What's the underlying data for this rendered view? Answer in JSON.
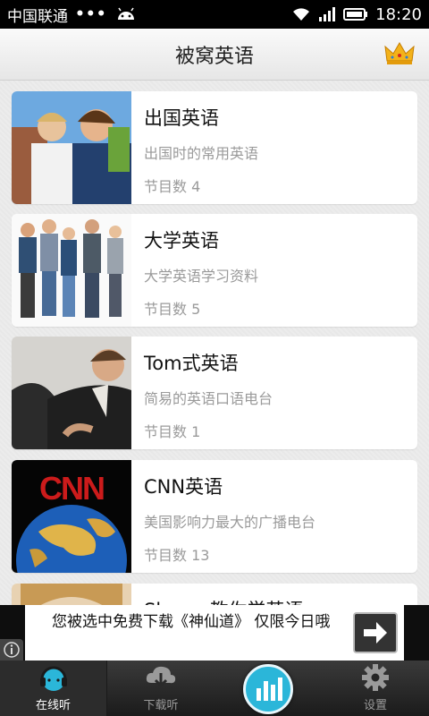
{
  "statusbar": {
    "carrier": "中国联通",
    "dots": "•••",
    "time": "18:20"
  },
  "header": {
    "title": "被窝英语"
  },
  "courses": [
    {
      "title": "出国英语",
      "subtitle": "出国时的常用英语",
      "count": "节目数 4"
    },
    {
      "title": "大学英语",
      "subtitle": "大学英语学习资料",
      "count": "节目数 5"
    },
    {
      "title": "Tom式英语",
      "subtitle": "简易的英语口语电台",
      "count": "节目数 1"
    },
    {
      "title": "CNN英语",
      "subtitle": "美国影响力最大的广播电台",
      "count": "节目数 13"
    },
    {
      "title": "Shoo…教你学英语"
    }
  ],
  "ad": {
    "text": "您被选中免费下载《神仙道》 仅限今日哦"
  },
  "tabs": [
    {
      "label": "在线听",
      "icon": "headphones-icon",
      "active": true
    },
    {
      "label": "下载听",
      "icon": "download-icon"
    },
    {
      "label": "",
      "icon": "equalizer-icon"
    },
    {
      "label": "设置",
      "icon": "gear-icon"
    }
  ],
  "colors": {
    "accent": "#2bb6d9",
    "header_bg": "#f2f2f2",
    "tabbar_bg": "#262626"
  }
}
